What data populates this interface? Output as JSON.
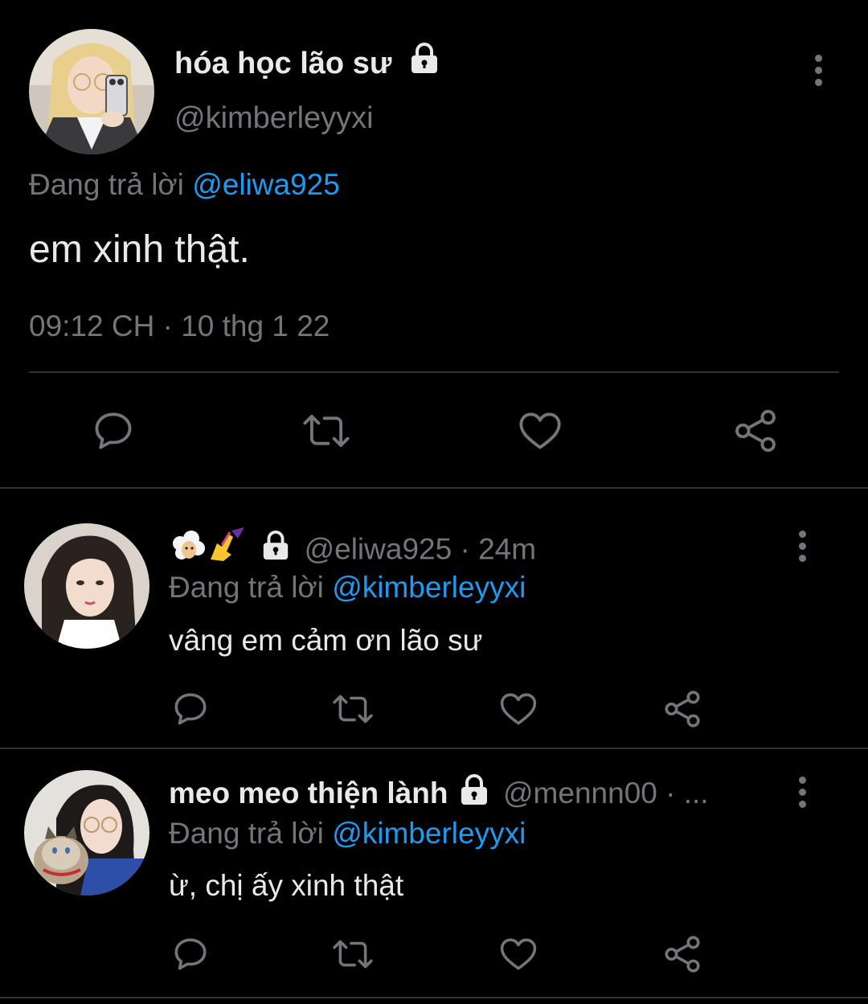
{
  "main_tweet": {
    "display_name": "hóa học lão sư",
    "handle": "@kimberleyyxi",
    "replying_to_prefix": "Đang trả lời",
    "replying_to": "@eliwa925",
    "text": "em xinh thật.",
    "timestamp": "09:12 CH · 10 thg 1 22",
    "locked": true
  },
  "replies": [
    {
      "display_name": "🐑✍️",
      "handle": "@eliwa925",
      "separator": "·",
      "time": "24m",
      "replying_to_prefix": "Đang trả lời",
      "replying_to": "@kimberleyyxi",
      "text": "vâng em cảm ơn lão sư",
      "locked": true
    },
    {
      "display_name": "meo meo thiện lành",
      "handle": "@mennn00",
      "separator": "·",
      "time": "...",
      "replying_to_prefix": "Đang trả lời",
      "replying_to": "@kimberleyyxi",
      "text": "ừ, chị ấy xinh thật",
      "locked": true
    }
  ],
  "icons": {
    "reply": "reply-icon",
    "retweet": "retweet-icon",
    "like": "heart-icon",
    "share": "share-icon",
    "more": "more-vertical-icon",
    "lock": "lock-icon"
  },
  "colors": {
    "background": "#000000",
    "text_primary": "#e7e9ea",
    "text_secondary": "#71767b",
    "link": "#1d9bf0",
    "divider": "#2f3336"
  }
}
